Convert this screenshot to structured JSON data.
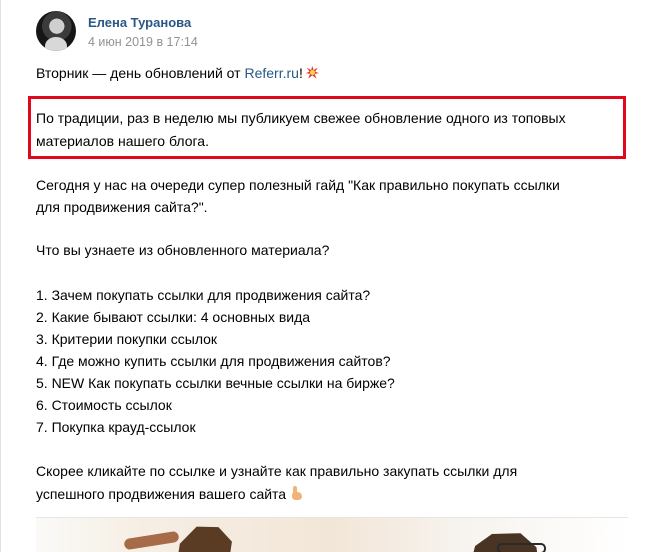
{
  "author": {
    "name": "Елена Туранова",
    "date": "4 июн 2019 в 17:14"
  },
  "post": {
    "intro": {
      "before": "Вторник — день обновлений от ",
      "link": "Referr.ru",
      "after": "!"
    },
    "highlight_lines": [
      "По традиции, раз в неделю мы публикуем свежее обновление одного из топовых",
      "материалов нашего блога."
    ],
    "guide_lines": [
      "Сегодня у нас на очереди супер полезный гайд \"Как правильно покупать ссылки",
      "для продвижения сайта?\"."
    ],
    "question": "Что вы узнаете из обновленного материала?",
    "items": [
      "1. Зачем покупать ссылки для продвижения сайта?",
      "2. Какие бывают ссылки: 4 основных вида",
      "3. Критерии покупки ссылок",
      "4. Где можно купить ссылки для продвижения сайтов?",
      "5. NEW Как покупать ссылки вечные ссылки на бирже?",
      "6. Стоимость ссылок",
      "7. Покупка крауд-ссылок"
    ],
    "cta_lines": [
      "Скорее кликайте по ссылке и узнайте как правильно закупать ссылки для",
      "успешного продвижения вашего сайта"
    ]
  },
  "icons": {
    "intro_emoji": "collision-emoji-icon",
    "cta_emoji": "pointing-hand-emoji-icon",
    "media_expand": "expand-icon"
  },
  "colors": {
    "link": "#2a5885",
    "date": "#939393",
    "highlight_border": "#e0081a"
  }
}
